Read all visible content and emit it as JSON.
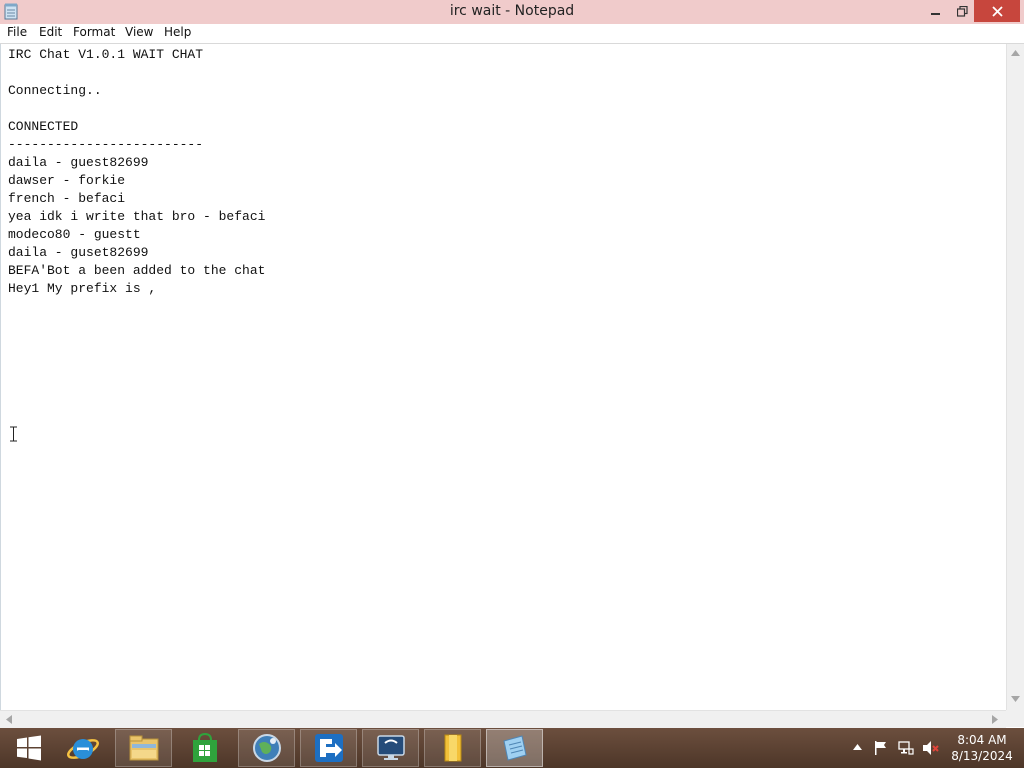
{
  "window": {
    "title": "irc wait - Notepad"
  },
  "menu": {
    "items": [
      "File",
      "Edit",
      "Format",
      "View",
      "Help"
    ]
  },
  "editor": {
    "lines": [
      "IRC Chat V1.0.1 WAIT CHAT",
      "",
      "Connecting..",
      "",
      "CONNECTED",
      "-------------------------",
      "daila - guest82699",
      "dawser - forkie",
      "french - befaci",
      "yea idk i write that bro - befaci",
      "modeco80 - guestt",
      "daila - guset82699",
      "BEFA'Bot a been added to the chat",
      "Hey1 My prefix is ,"
    ]
  },
  "taskbar": {
    "apps": [
      {
        "name": "start-button",
        "icon": "windows-logo-icon"
      },
      {
        "name": "taskbar-internet-explorer",
        "icon": "internet-explorer-icon"
      },
      {
        "name": "taskbar-file-explorer",
        "icon": "folder-icon"
      },
      {
        "name": "taskbar-store",
        "icon": "store-bag-icon"
      },
      {
        "name": "taskbar-globe-app",
        "icon": "globe-icon"
      },
      {
        "name": "taskbar-ftp-app",
        "icon": "transfer-arrow-icon"
      },
      {
        "name": "taskbar-monitor-app",
        "icon": "monitor-icon"
      },
      {
        "name": "taskbar-folder-app",
        "icon": "yellow-folder-icon"
      },
      {
        "name": "taskbar-notepad",
        "icon": "notepad-icon"
      }
    ],
    "tray_icons": [
      "chevron-up-icon",
      "flag-icon",
      "network-icon",
      "volume-muted-icon"
    ],
    "clock": {
      "time": "8:04 AM",
      "date": "8/13/2024"
    }
  },
  "colors": {
    "titlebar": "#f0cbcb",
    "close_button": "#c7463d",
    "taskbar": "#5a3f30"
  }
}
